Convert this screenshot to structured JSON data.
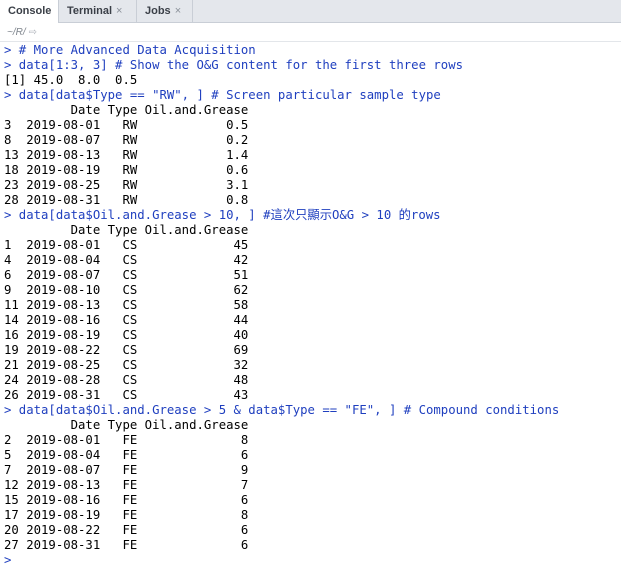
{
  "tabs": [
    {
      "label": "Console"
    },
    {
      "label": "Terminal",
      "close": "×"
    },
    {
      "label": "Jobs",
      "close": "×"
    }
  ],
  "path": {
    "text": "~/R/",
    "arrow": "⇨"
  },
  "console_lines": [
    {
      "kind": "cmd",
      "text": "> # More Advanced Data Acquisition"
    },
    {
      "kind": "cmd",
      "text": "> data[1:3, 3] # Show the O&G content for the first three rows"
    },
    {
      "kind": "out",
      "text": "[1] 45.0  8.0  0.5"
    },
    {
      "kind": "cmd",
      "text": "> data[data$Type == \"RW\", ] # Screen particular sample type"
    },
    {
      "kind": "out",
      "text": "         Date Type Oil.and.Grease"
    },
    {
      "kind": "out",
      "text": "3  2019-08-01   RW            0.5"
    },
    {
      "kind": "out",
      "text": "8  2019-08-07   RW            0.2"
    },
    {
      "kind": "out",
      "text": "13 2019-08-13   RW            1.4"
    },
    {
      "kind": "out",
      "text": "18 2019-08-19   RW            0.6"
    },
    {
      "kind": "out",
      "text": "23 2019-08-25   RW            3.1"
    },
    {
      "kind": "out",
      "text": "28 2019-08-31   RW            0.8"
    },
    {
      "kind": "cmd",
      "text": "> data[data$Oil.and.Grease > 10, ] #這次只顯示O&G > 10 的rows"
    },
    {
      "kind": "out",
      "text": "         Date Type Oil.and.Grease"
    },
    {
      "kind": "out",
      "text": "1  2019-08-01   CS             45"
    },
    {
      "kind": "out",
      "text": "4  2019-08-04   CS             42"
    },
    {
      "kind": "out",
      "text": "6  2019-08-07   CS             51"
    },
    {
      "kind": "out",
      "text": "9  2019-08-10   CS             62"
    },
    {
      "kind": "out",
      "text": "11 2019-08-13   CS             58"
    },
    {
      "kind": "out",
      "text": "14 2019-08-16   CS             44"
    },
    {
      "kind": "out",
      "text": "16 2019-08-19   CS             40"
    },
    {
      "kind": "out",
      "text": "19 2019-08-22   CS             69"
    },
    {
      "kind": "out",
      "text": "21 2019-08-25   CS             32"
    },
    {
      "kind": "out",
      "text": "24 2019-08-28   CS             48"
    },
    {
      "kind": "out",
      "text": "26 2019-08-31   CS             43"
    },
    {
      "kind": "cmd",
      "text": "> data[data$Oil.and.Grease > 5 & data$Type == \"FE\", ] # Compound conditions"
    },
    {
      "kind": "out",
      "text": "         Date Type Oil.and.Grease"
    },
    {
      "kind": "out",
      "text": "2  2019-08-01   FE              8"
    },
    {
      "kind": "out",
      "text": "5  2019-08-04   FE              6"
    },
    {
      "kind": "out",
      "text": "7  2019-08-07   FE              9"
    },
    {
      "kind": "out",
      "text": "12 2019-08-13   FE              7"
    },
    {
      "kind": "out",
      "text": "15 2019-08-16   FE              6"
    },
    {
      "kind": "out",
      "text": "17 2019-08-19   FE              8"
    },
    {
      "kind": "out",
      "text": "20 2019-08-22   FE              6"
    },
    {
      "kind": "out",
      "text": "27 2019-08-31   FE              6"
    },
    {
      "kind": "cmd",
      "text": ">"
    }
  ],
  "colors": {
    "command": "#1f3fbf",
    "output": "#000000"
  }
}
